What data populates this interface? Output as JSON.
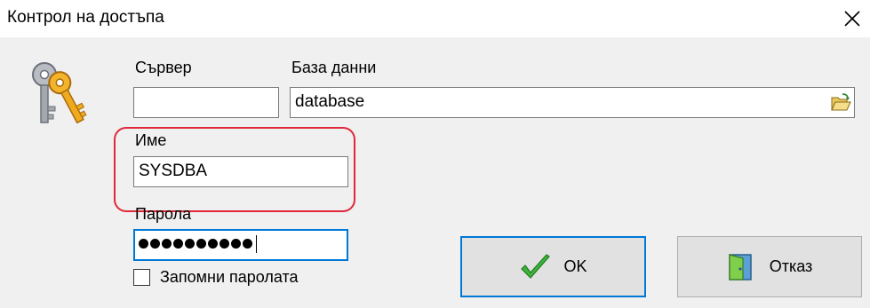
{
  "window": {
    "title": "Контрол на достъпа"
  },
  "labels": {
    "server": "Сървер",
    "database": "База данни",
    "name": "Име",
    "password": "Парола"
  },
  "fields": {
    "server_value": "",
    "database_value": "database",
    "name_value": "SYSDBA",
    "password_masked_length": 10
  },
  "checkbox": {
    "label": "Запомни паролата",
    "checked": false
  },
  "buttons": {
    "ok_label": "OK",
    "cancel_label": "Отказ"
  },
  "colors": {
    "focus": "#0078d7",
    "highlight": "#e0283a",
    "ok_check": "#2eaa2e"
  },
  "icons": [
    "keys-icon",
    "close-icon",
    "folder-open-icon",
    "checkmark-icon",
    "door-exit-icon"
  ]
}
